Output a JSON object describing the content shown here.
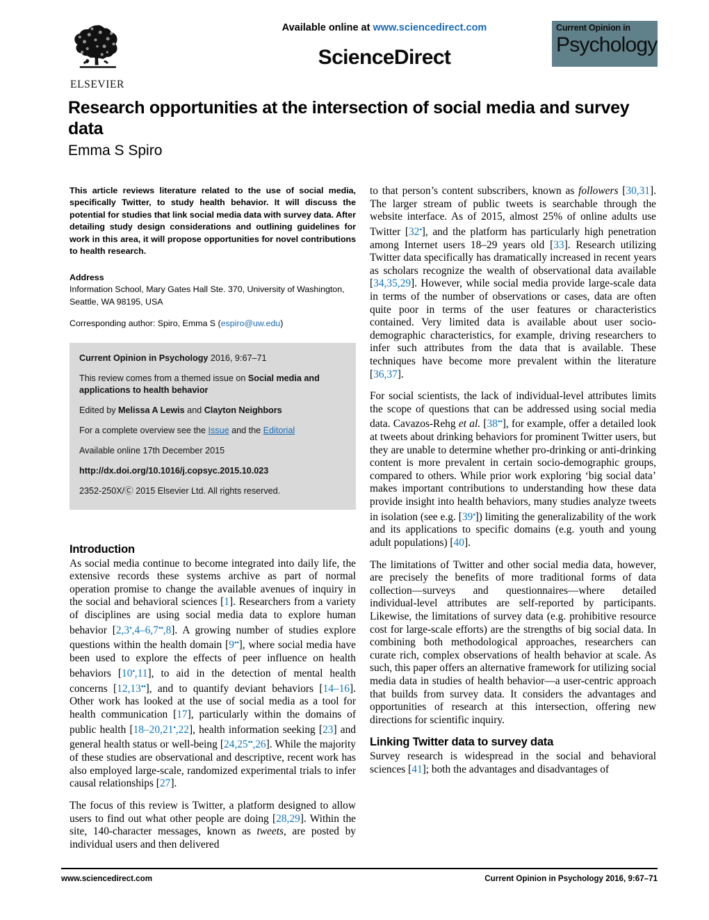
{
  "masthead": {
    "available_online_prefix": "Available online at ",
    "available_online_url": "www.sciencedirect.com",
    "sciencedirect_logo": "ScienceDirect",
    "elsevier_name": "ELSEVIER",
    "journal_logo_small": "Current Opinion in",
    "journal_logo_big": "Psychology",
    "journal_logo_bg": "#60808a"
  },
  "title_block": {
    "title": "Research opportunities at the intersection of social media and survey data",
    "author": "Emma S Spiro"
  },
  "abstract": {
    "text": "This article reviews literature related to the use of social media, specifically Twitter, to study health behavior. It will discuss the potential for studies that link social media data with survey data. After detailing study design considerations and outlining guidelines for work in this area, it will propose opportunities for novel contributions to health research."
  },
  "address": {
    "heading": "Address",
    "body": "Information School, Mary Gates Hall Ste. 370, University of Washington, Seattle, WA 98195, USA",
    "corresponding_prefix": "Corresponding author: Spiro, Emma S (",
    "corresponding_email": "espiro@uw.edu",
    "corresponding_suffix": ")"
  },
  "meta_box": {
    "journal_citation_bold": "Current Opinion in Psychology",
    "journal_citation_rest": " 2016, 9:67–71",
    "themed_issue_prefix": "This review comes from a themed issue on ",
    "themed_issue_bold": "Social media and applications to health behavior",
    "edited_by_prefix": "Edited by ",
    "edited_by_1": "Melissa A Lewis",
    "edited_by_joiner": " and ",
    "edited_by_2": "Clayton Neighbors",
    "overview_prefix": "For a complete overview see the ",
    "overview_link_1": "Issue",
    "overview_mid": " and the ",
    "overview_link_2": "Editorial",
    "available_online": "Available online 17th December 2015",
    "doi": "http://dx.doi.org/10.1016/j.copsyc.2015.10.023",
    "copyright_issn": "2352-250X/",
    "copyright_symbol": "Ⓒ",
    "copyright_rest": " 2015 Elsevier Ltd. All rights reserved.",
    "bg_color": "#d9d9d9"
  },
  "left_column": {
    "intro_heading": "Introduction",
    "intro_p1": [
      {
        "t": "As social media continue to become integrated into daily life, the extensive records these systems archive as part of normal operation promise to change the available avenues of inquiry in the social and behavioral sciences ["
      },
      {
        "t": "1",
        "ref": true
      },
      {
        "t": "]. Researchers from a variety of disciplines are using social media data to explore human behavior ["
      },
      {
        "t": "2,3",
        "ref": true
      },
      {
        "t": "•",
        "ref": true,
        "sup": true
      },
      {
        "t": ",4–6,7",
        "ref": true
      },
      {
        "t": "••",
        "ref": true,
        "sup": true
      },
      {
        "t": ",8",
        "ref": true
      },
      {
        "t": "]. A growing number of studies explore questions within the health domain ["
      },
      {
        "t": "9",
        "ref": true
      },
      {
        "t": "••",
        "ref": true,
        "sup": true
      },
      {
        "t": "], where social media have been used to explore the effects of peer influence on health behaviors ["
      },
      {
        "t": "10",
        "ref": true
      },
      {
        "t": "•",
        "ref": true,
        "sup": true
      },
      {
        "t": ",11",
        "ref": true
      },
      {
        "t": "], to aid in the detection of mental health concerns ["
      },
      {
        "t": "12,13",
        "ref": true
      },
      {
        "t": "••",
        "ref": true,
        "sup": true
      },
      {
        "t": "], and to quantify deviant behaviors ["
      },
      {
        "t": "14–16",
        "ref": true
      },
      {
        "t": "]. Other work has looked at the use of social media as a tool for health communication ["
      },
      {
        "t": "17",
        "ref": true
      },
      {
        "t": "], particularly within the domains of public health ["
      },
      {
        "t": "18–20,21",
        "ref": true
      },
      {
        "t": "•",
        "ref": true,
        "sup": true
      },
      {
        "t": ",22",
        "ref": true
      },
      {
        "t": "], health information seeking ["
      },
      {
        "t": "23",
        "ref": true
      },
      {
        "t": "] and general health status or well-being ["
      },
      {
        "t": "24,25",
        "ref": true
      },
      {
        "t": "••",
        "ref": true,
        "sup": true
      },
      {
        "t": ",26",
        "ref": true
      },
      {
        "t": "]. While the majority of these studies are observational and descriptive, recent work has also employed large-scale, randomized experimental trials to infer causal relationships ["
      },
      {
        "t": "27",
        "ref": true
      },
      {
        "t": "]."
      }
    ],
    "intro_p2": [
      {
        "t": "The focus of this review is Twitter, a platform designed to allow users to find out what other people are doing ["
      },
      {
        "t": "28,29",
        "ref": true
      },
      {
        "t": "]. Within the site, 140-character messages, known as "
      },
      {
        "t": "tweets",
        "ital": true
      },
      {
        "t": ", are posted by individual users and then delivered"
      }
    ]
  },
  "right_column": {
    "p1": [
      {
        "t": "to that person’s content subscribers, known as "
      },
      {
        "t": "followers",
        "ital": true
      },
      {
        "t": " ["
      },
      {
        "t": "30,31",
        "ref": true
      },
      {
        "t": "]. The larger stream of public tweets is searchable through the website interface. As of 2015, almost 25% of online adults use Twitter ["
      },
      {
        "t": "32",
        "ref": true
      },
      {
        "t": "•",
        "ref": true,
        "sup": true
      },
      {
        "t": "], and the platform has particularly high penetration among Internet users 18–29 years old ["
      },
      {
        "t": "33",
        "ref": true
      },
      {
        "t": "]. Research utilizing Twitter data specifically has dramatically increased in recent years as scholars recognize the wealth of observational data available ["
      },
      {
        "t": "34,35,29",
        "ref": true
      },
      {
        "t": "]. However, while social media provide large-scale data in terms of the number of observations or cases, data are often quite poor in terms of the user features or characteristics contained. Very limited data is available about user socio-demographic characteristics, for example, driving researchers to infer such attributes from the data that is available. These techniques have become more prevalent within the literature ["
      },
      {
        "t": "36,37",
        "ref": true
      },
      {
        "t": "]."
      }
    ],
    "p2": [
      {
        "t": "For social scientists, the lack of individual-level attributes limits the scope of questions that can be addressed using social media data. Cavazos-Rehg "
      },
      {
        "t": "et al.",
        "ital": true
      },
      {
        "t": " ["
      },
      {
        "t": "38",
        "ref": true
      },
      {
        "t": "••",
        "ref": true,
        "sup": true
      },
      {
        "t": "], for example, offer a detailed look at tweets about drinking behaviors for prominent Twitter users, but they are unable to determine whether pro-drinking or anti-drinking content is more prevalent in certain socio-demographic groups, compared to others. While prior work exploring ‘big social data’ makes important contributions to understanding how these data provide insight into health behaviors, many studies analyze tweets in isolation (see e.g. ["
      },
      {
        "t": "39",
        "ref": true
      },
      {
        "t": "•",
        "ref": true,
        "sup": true
      },
      {
        "t": "]) limiting the generalizability of the work and its applications to specific domains (e.g. youth and young adult populations) ["
      },
      {
        "t": "40",
        "ref": true
      },
      {
        "t": "]."
      }
    ],
    "p3": [
      {
        "t": "The limitations of Twitter and other social media data, however, are precisely the benefits of more traditional forms of data collection—surveys and questionnaires—where detailed individual-level attributes are self-reported by participants. Likewise, the limitations of survey data (e.g. prohibitive resource cost for large-scale efforts) are the strengths of big social data. In combining both methodological approaches, researchers can curate rich, complex observations of health behavior at scale. As such, this paper offers an alternative framework for utilizing social media data in studies of health behavior—a user-centric approach that builds from survey data. It considers the advantages and opportunities of research at this intersection, offering new directions for scientific inquiry."
      }
    ],
    "section_heading": "Linking Twitter data to survey data",
    "p4": [
      {
        "t": "Survey research is widespread in the social and behavioral sciences ["
      },
      {
        "t": "41",
        "ref": true
      },
      {
        "t": "]; both the advantages and disadvantages of"
      }
    ]
  },
  "footer": {
    "left": "www.sciencedirect.com",
    "right_bold": "Current Opinion in Psychology",
    "right_rest": " 2016, 9:67–71"
  }
}
